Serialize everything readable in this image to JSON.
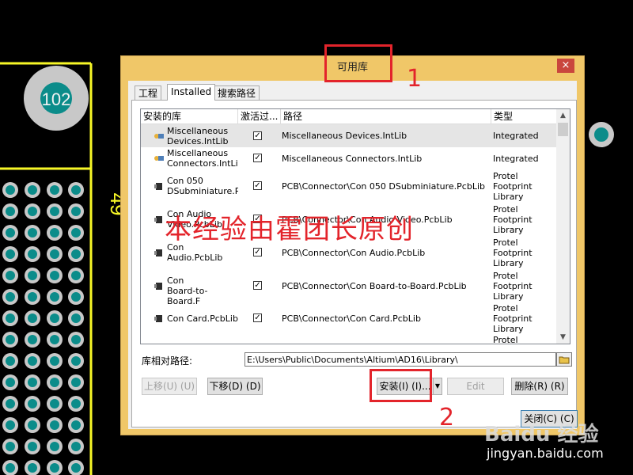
{
  "pcb": {
    "big_pad_label": "102",
    "side_label": "49"
  },
  "dialog": {
    "title": "可用库",
    "close_label": "×",
    "tabs": [
      {
        "label": "工程"
      },
      {
        "label": "Installed"
      },
      {
        "label": "搜索路径"
      }
    ],
    "columns": [
      "安装的库",
      "激活过...",
      "路径",
      "类型"
    ],
    "rows": [
      {
        "name": "Miscellaneous\nDevices.IntLib",
        "active": true,
        "path": "Miscellaneous Devices.IntLib",
        "type": "Integrated"
      },
      {
        "name": "Miscellaneous\nConnectors.IntLit",
        "active": true,
        "path": "Miscellaneous Connectors.IntLib",
        "type": "Integrated"
      },
      {
        "name": "Con 050\nDSubminiature.P",
        "active": true,
        "path": "PCB\\Connector\\Con 050 DSubminiature.PcbLib",
        "type": "Protel\nFootprint\nLibrary"
      },
      {
        "name": "Con Audio\nVideo.PcbLib",
        "active": true,
        "path": "PCB\\Connector\\Con Audio Video.PcbLib",
        "type": "Protel\nFootprint\nLibrary"
      },
      {
        "name": "Con\nAudio.PcbLib",
        "active": true,
        "path": "PCB\\Connector\\Con Audio.PcbLib",
        "type": "Protel\nFootprint\nLibrary"
      },
      {
        "name": "Con\nBoard-to-Board.F",
        "active": true,
        "path": "PCB\\Connector\\Con Board-to-Board.PcbLib",
        "type": "Protel\nFootprint\nLibrary"
      },
      {
        "name": "Con Card.PcbLib",
        "active": true,
        "path": "PCB\\Connector\\Con Card.PcbLib",
        "type": "Protel\nFootprint\nLibrary"
      },
      {
        "name": "",
        "active": false,
        "path": "",
        "type": "Protel"
      }
    ],
    "path_label": "库相对路径:",
    "path_value": "E:\\Users\\Public\\Documents\\Altium\\AD16\\Library\\",
    "buttons": {
      "move_up": "上移(U) (U)",
      "move_down": "下移(D) (D)",
      "install": "安装(I) (I)...",
      "edit": "Edit",
      "remove": "删除(R) (R)",
      "close": "关闭(C) (C)"
    }
  },
  "annotations": {
    "num1": "1",
    "num2": "2",
    "watermark": "本经验由霍团长原创"
  },
  "brand": {
    "logo": "Baidu 经验",
    "url": "jingyan.baidu.com"
  },
  "colors": {
    "dialog_frame": "#f0c768",
    "annotation_red": "#e3242b",
    "pcb_yellow": "#f7f727",
    "pad_teal": "#0b8c8a",
    "pad_rim": "#c8c8c8"
  }
}
